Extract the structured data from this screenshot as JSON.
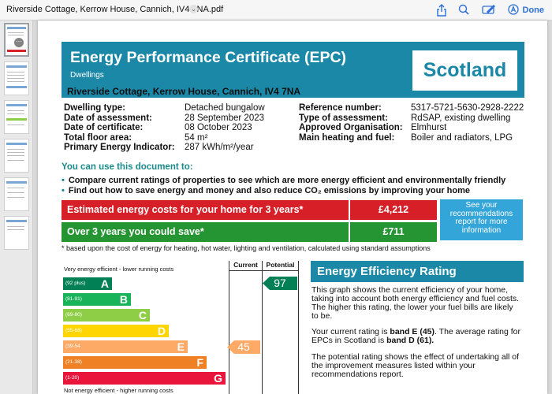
{
  "toolbar": {
    "title": "Riverside Cottage, Kerrow House, Cannich, IV4 7NA.pdf",
    "chevron": "⌄",
    "done_label": "Done",
    "icons": [
      "share-icon",
      "search-icon",
      "markup-icon",
      "account-icon"
    ]
  },
  "sidebar": {
    "more": "···"
  },
  "certificate": {
    "title": "Energy Performance Certificate (EPC)",
    "subtitle": "Dwellings",
    "country": "Scotland",
    "address": "Riverside Cottage, Kerrow House, Cannich, IV4 7NA",
    "left_fields": [
      {
        "label": "Dwelling type:",
        "value": "Detached bungalow"
      },
      {
        "label": "Date of assessment:",
        "value": "28 September 2023"
      },
      {
        "label": "Date of certificate:",
        "value": "08 October 2023"
      },
      {
        "label": "Total floor area:",
        "value": "54 m²"
      },
      {
        "label": "Primary Energy Indicator:",
        "value": "287 kWh/m²/year"
      }
    ],
    "right_fields": [
      {
        "label": "Reference number:",
        "value": "5317-5721-5630-2928-2222"
      },
      {
        "label": "Type of assessment:",
        "value": "RdSAP, existing dwelling"
      },
      {
        "label": "Approved Organisation:",
        "value": "Elmhurst"
      },
      {
        "label": "Main heating and fuel:",
        "value": "Boiler and radiators, LPG"
      }
    ],
    "use_heading": "You can use this document to:",
    "bullets": [
      "Compare current ratings of properties to see which are more energy efficient and environmentally friendly",
      "Find out how to save energy and money and also reduce CO₂ emissions by improving your home"
    ],
    "costs": [
      {
        "label": "Estimated energy costs for your home for 3 years*",
        "value": "£4,212"
      },
      {
        "label": "Over 3 years you could save*",
        "value": "£711"
      }
    ],
    "recommendations_link": "See your recommendations report for more information",
    "footnote": "* based upon the cost of energy for heating, hot water, lighting and ventilation, calculated using standard assumptions"
  },
  "eer_chart": {
    "top_label": "Very energy efficient - lower running costs",
    "bottom_label": "Not energy efficient - higher running costs",
    "column_current": "Current",
    "column_potential": "Potential",
    "bands": [
      {
        "range": "(92 plus)",
        "letter": "A",
        "color": "#008054"
      },
      {
        "range": "(81-91)",
        "letter": "B",
        "color": "#19b459"
      },
      {
        "range": "(69-80)",
        "letter": "C",
        "color": "#8dce46"
      },
      {
        "range": "(55-68)",
        "letter": "D",
        "color": "#ffd500"
      },
      {
        "range": "(39-54",
        "letter": "E",
        "color": "#fcaa65"
      },
      {
        "range": "(21-38)",
        "letter": "F",
        "color": "#ef8023"
      },
      {
        "range": "(1-20)",
        "letter": "G",
        "color": "#e9153b"
      }
    ],
    "current": {
      "value": "45",
      "band": "E",
      "color": "#fcaa65"
    },
    "potential": {
      "value": "97",
      "band": "A",
      "color": "#008054"
    }
  },
  "eer_text": {
    "heading": "Energy Efficiency Rating",
    "p1": "This graph shows the current efficiency of your home, taking into account both energy efficiency and fuel costs. The higher this rating, the lower your fuel bills are likely to be.",
    "p2_a": "Your current rating is ",
    "p2_b": "band E (45)",
    "p2_c": ". The average rating for EPCs in Scotland is ",
    "p2_d": "band D (61).",
    "p3": "The potential rating shows the effect of undertaking all of the improvement measures listed within your recommendations report."
  }
}
